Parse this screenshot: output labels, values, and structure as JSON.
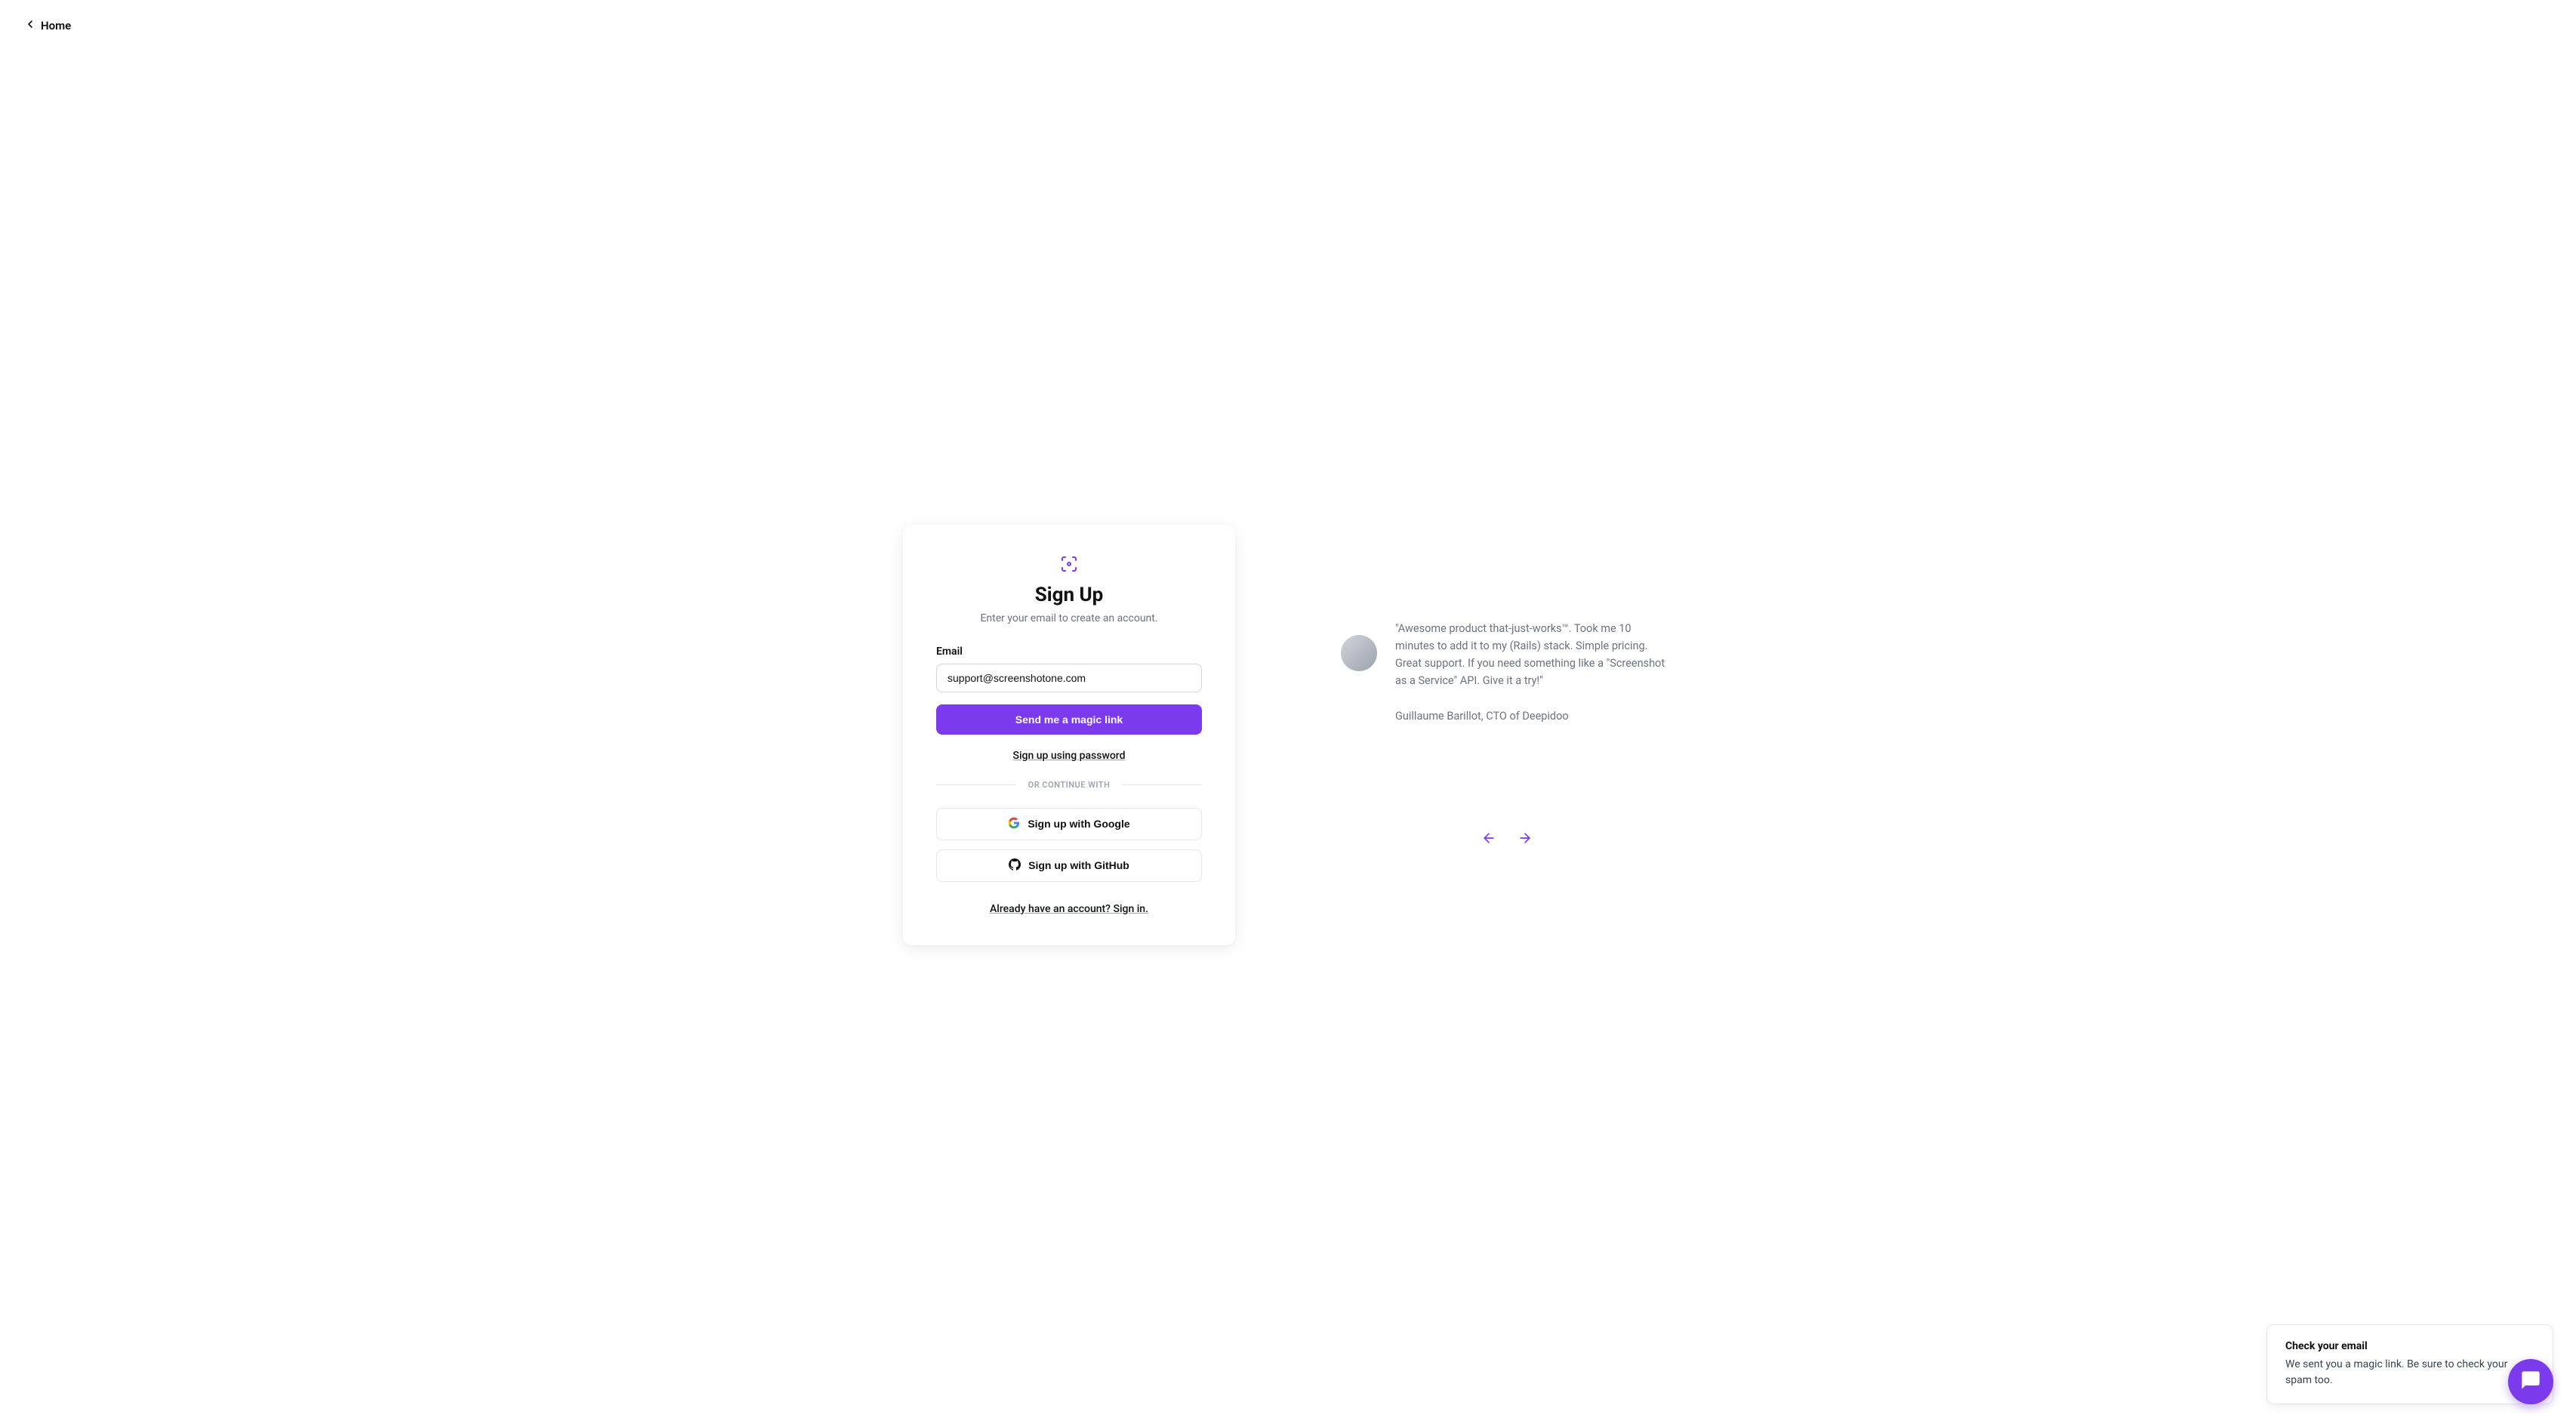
{
  "header": {
    "home_label": "Home"
  },
  "signup": {
    "title": "Sign Up",
    "subtitle": "Enter your email to create an account.",
    "email_label": "Email",
    "email_value": "support@screenshotone.com",
    "submit_label": "Send me a magic link",
    "password_link": "Sign up using password",
    "divider_text": "OR CONTINUE WITH",
    "google_label": "Sign up with Google",
    "github_label": "Sign up with GitHub",
    "signin_link": "Already have an account? Sign in."
  },
  "testimonial": {
    "quote": "\"Awesome product that-just-works™. Took me 10 minutes to add it to my (Rails) stack. Simple pricing. Great support. If you need something like a \"Screenshot as a Service\" API. Give it a try!\"",
    "author": "Guillaume Barillot, CTO of Deepidoo"
  },
  "toast": {
    "title": "Check your email",
    "message": "We sent you a magic link. Be sure to check your spam too."
  },
  "colors": {
    "primary": "#7c3aed",
    "text": "#111",
    "muted": "#6b7280",
    "border": "#e5e7eb"
  }
}
